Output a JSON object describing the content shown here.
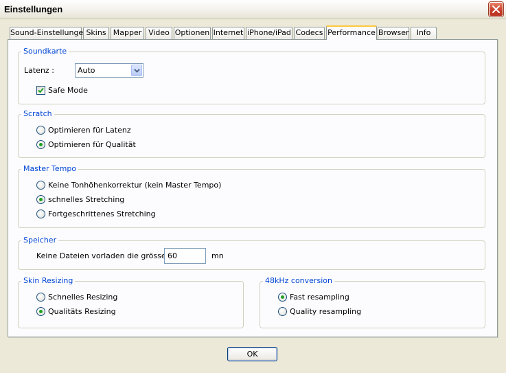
{
  "window": {
    "title": "Einstellungen",
    "close_icon": "close-icon"
  },
  "tabs": [
    {
      "label": "Sound-Einstellungen"
    },
    {
      "label": "Skins"
    },
    {
      "label": "Mapper"
    },
    {
      "label": "Video"
    },
    {
      "label": "Optionen"
    },
    {
      "label": "Internet"
    },
    {
      "label": "iPhone/iPad"
    },
    {
      "label": "Codecs"
    },
    {
      "label": "Performance",
      "active": true
    },
    {
      "label": "Browser"
    },
    {
      "label": "Info"
    }
  ],
  "soundkarte": {
    "title": "Soundkarte",
    "latency_label": "Latenz :",
    "latency_value": "Auto",
    "safe_mode_label": "Safe Mode",
    "safe_mode_checked": true
  },
  "scratch": {
    "title": "Scratch",
    "options": [
      {
        "label": "Optimieren für Latenz",
        "checked": false
      },
      {
        "label": "Optimieren für Qualität",
        "checked": true
      }
    ]
  },
  "master_tempo": {
    "title": "Master Tempo",
    "options": [
      {
        "label": "Keine Tonhöhenkorrektur (kein Master Tempo)",
        "checked": false
      },
      {
        "label": "schnelles Stretching",
        "checked": true
      },
      {
        "label": "Fortgeschrittenes Stretching",
        "checked": false
      }
    ]
  },
  "speicher": {
    "title": "Speicher",
    "label": "Keine Dateien vorladen die grösser",
    "value": "60",
    "unit": "mn"
  },
  "skin_resizing": {
    "title": "Skin Resizing",
    "options": [
      {
        "label": "Schnelles Resizing",
        "checked": false
      },
      {
        "label": "Qualitäts Resizing",
        "checked": true
      }
    ]
  },
  "conversion": {
    "title": "48kHz conversion",
    "options": [
      {
        "label": "Fast resampling",
        "checked": true
      },
      {
        "label": "Quality resampling",
        "checked": false
      }
    ]
  },
  "buttons": {
    "ok": "OK"
  },
  "colors": {
    "group_title": "#0046d5",
    "active_tab_accent": "#ffc73c",
    "radio_dot": "#21a121",
    "dialog_bg": "#ece9d8"
  }
}
